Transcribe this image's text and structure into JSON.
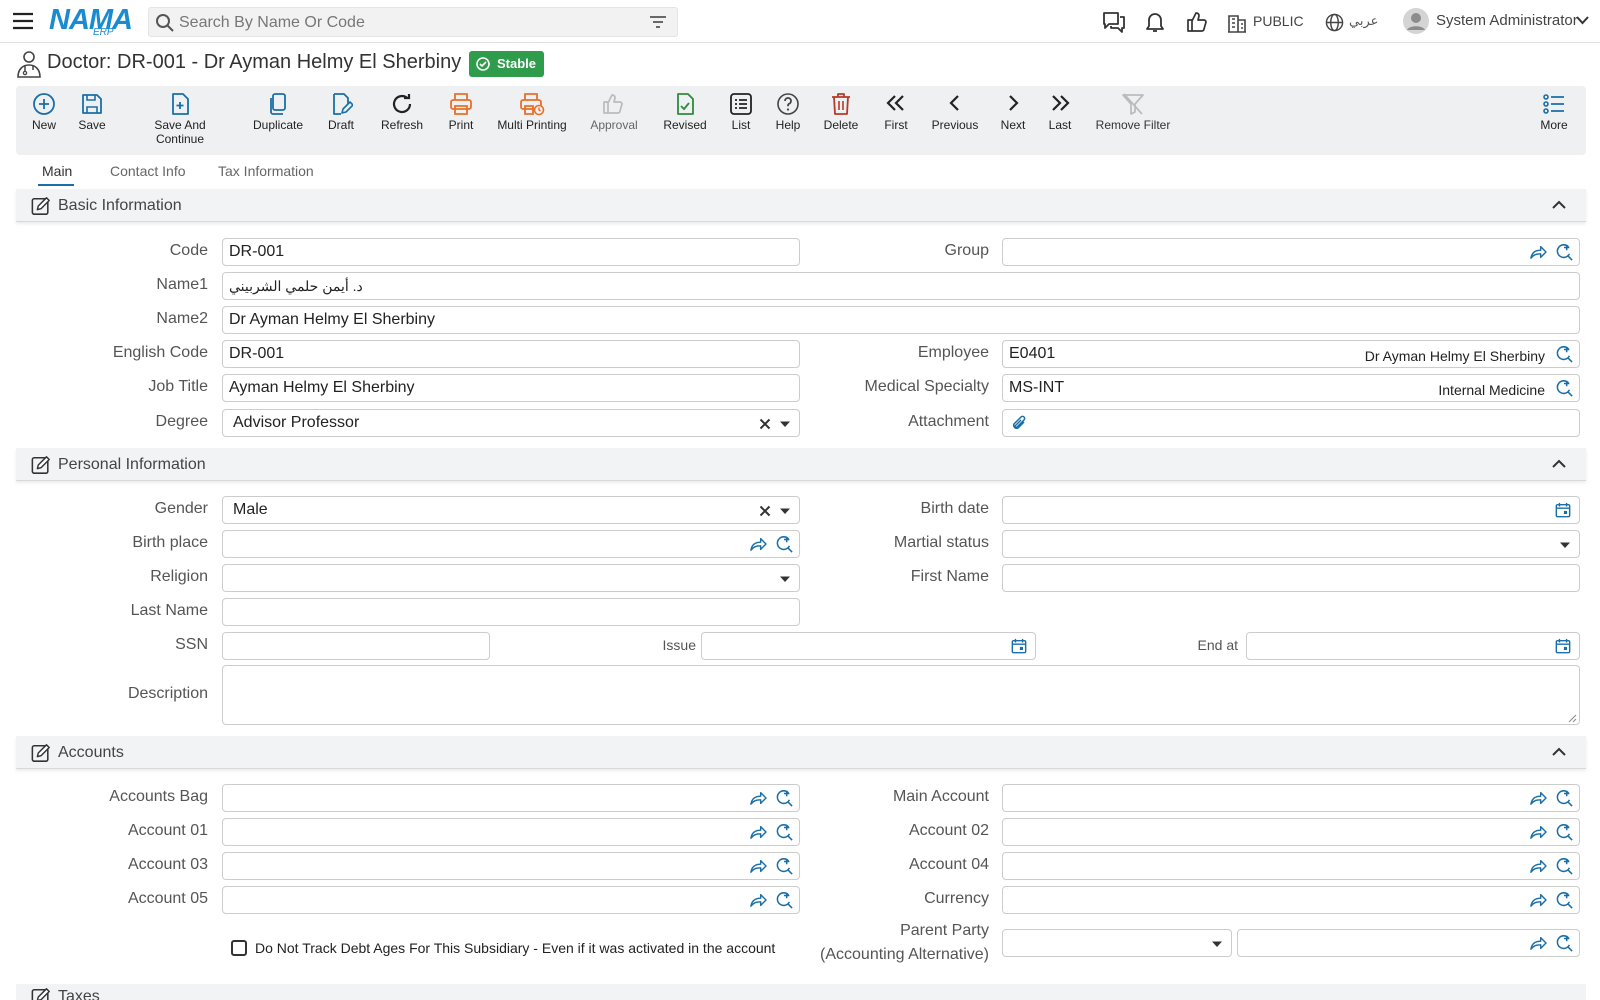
{
  "topbar": {
    "brand": "NAMA",
    "brand_sub": "ERP",
    "search_placeholder": "Search By Name Or Code",
    "org": "PUBLIC",
    "language": "عربي",
    "user": "System Administrator"
  },
  "page": {
    "title": "Doctor: DR-001 - Dr Ayman Helmy El Sherbiny",
    "status": "Stable"
  },
  "toolbar": {
    "new": "New",
    "save": "Save",
    "save_continue": "Save And Continue",
    "duplicate": "Duplicate",
    "draft": "Draft",
    "refresh": "Refresh",
    "print": "Print",
    "multi_printing": "Multi Printing",
    "approval": "Approval",
    "revised": "Revised",
    "list": "List",
    "help": "Help",
    "delete": "Delete",
    "first": "First",
    "previous": "Previous",
    "next": "Next",
    "last": "Last",
    "remove_filter": "Remove Filter",
    "more": "More"
  },
  "tabs": [
    "Main",
    "Contact Info",
    "Tax Information"
  ],
  "basic": {
    "header": "Basic Information",
    "code_label": "Code",
    "code": "DR-001",
    "group_label": "Group",
    "group": "",
    "name1_label": "Name1",
    "name1": "د. أيمن حلمي الشربيني",
    "name2_label": "Name2",
    "name2": "Dr Ayman Helmy El Sherbiny",
    "english_code_label": "English Code",
    "english_code": "DR-001",
    "employee_label": "Employee",
    "employee_code": "E0401",
    "employee_name": "Dr Ayman Helmy El Sherbiny",
    "job_title_label": "Job Title",
    "job_title": "Ayman Helmy El Sherbiny",
    "specialty_label": "Medical Specialty",
    "specialty_code": "MS-INT",
    "specialty_name": "Internal Medicine",
    "degree_label": "Degree",
    "degree": "Advisor Professor",
    "attachment_label": "Attachment"
  },
  "personal": {
    "header": "Personal Information",
    "gender_label": "Gender",
    "gender": "Male",
    "birth_date_label": "Birth date",
    "birth_place_label": "Birth place",
    "marital_label": "Martial status",
    "religion_label": "Religion",
    "first_name_label": "First Name",
    "last_name_label": "Last Name",
    "ssn_label": "SSN",
    "issue_label": "Issue",
    "end_at_label": "End at",
    "description_label": "Description"
  },
  "accounts": {
    "header": "Accounts",
    "accounts_bag_label": "Accounts Bag",
    "main_account_label": "Main Account",
    "account01_label": "Account 01",
    "account02_label": "Account 02",
    "account03_label": "Account 03",
    "account04_label": "Account 04",
    "account05_label": "Account 05",
    "currency_label": "Currency",
    "parent_party_label_1": "Parent Party",
    "parent_party_label_2": "(Accounting Alternative)",
    "debt_ages_checkbox": "Do Not Track Debt Ages For This Subsidiary - Even if it was activated in the account"
  },
  "next_section": "Taxes",
  "colors": {
    "accent": "#1a8bd0",
    "status": "#2e9c4a",
    "link_icon": "#1a6fa8"
  }
}
